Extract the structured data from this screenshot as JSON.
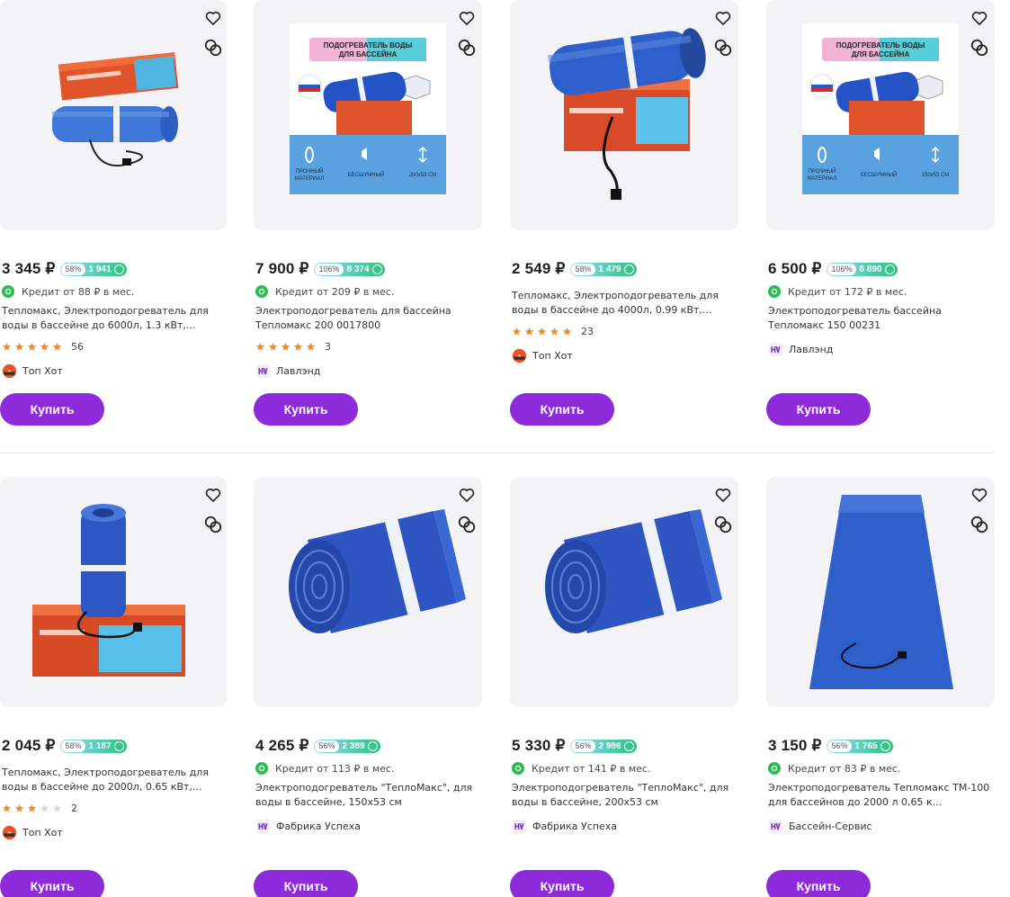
{
  "currency": "₽",
  "buy_label": "Купить",
  "colors": {
    "accent": "#8d2bdb",
    "credit": "#2bbd53",
    "star": "#f28a2a",
    "bonus_from": "#9ad8ff",
    "bonus_to": "#28c27b"
  },
  "products": [
    {
      "price": "3 345 ₽",
      "bonus_pct": "58%",
      "bonus_value": "1 941",
      "credit": "Кредит от 88 ₽ в мес.",
      "title": "Тепломакс, Электроподогреватель для воды в бассейне до 6000л, 1.3 кВт,...",
      "rating": 5,
      "reviews": "56",
      "seller": "Топ Хот",
      "seller_icon": "tophot-logo-icon",
      "image": "rolled-heater-with-box"
    },
    {
      "price": "7 900 ₽",
      "bonus_pct": "106%",
      "bonus_value": "8 374",
      "credit": "Кредит от 209 ₽ в мес.",
      "title": "Электроподогреватель для бассейна Тепломакс 200 0017800",
      "rating": 5,
      "reviews": "3",
      "seller": "Лавлэнд",
      "seller_icon": "lavland-logo-icon",
      "image": "promo-card",
      "promo": {
        "banner": "ПОДОГРЕВАТЕЛЬ ВОДЫ ДЛЯ БАССЕЙНА",
        "features": [
          "ПРОЧНЫЙ МАТЕРИАЛ",
          "БЕСШУМНЫЙ",
          "200х53 СМ"
        ]
      }
    },
    {
      "price": "2 549 ₽",
      "bonus_pct": "58%",
      "bonus_value": "1 479",
      "credit": "",
      "title": "Тепломакс, Электроподогреватель для воды в бассейне до 4000л, 0.99 кВт,...",
      "rating": 5,
      "reviews": "23",
      "seller": "Топ Хот",
      "seller_icon": "tophot-logo-icon",
      "image": "rolled-heater-on-box"
    },
    {
      "price": "6 500 ₽",
      "bonus_pct": "106%",
      "bonus_value": "6 890",
      "credit": "Кредит от 172 ₽ в мес.",
      "title": "Электроподогреватель бассейна Тепломакс 150 00231",
      "rating": 0,
      "reviews": "",
      "seller": "Лавлэнд",
      "seller_icon": "lavland-logo-icon",
      "image": "promo-card",
      "promo": {
        "banner": "ПОДОГРЕВАТЕЛЬ ВОДЫ ДЛЯ БАССЕЙНА",
        "features": [
          "ПРОЧНЫЙ МАТЕРИАЛ",
          "БЕСШУМНЫЙ",
          "150х53 СМ"
        ]
      }
    },
    {
      "price": "2 045 ₽",
      "bonus_pct": "58%",
      "bonus_value": "1 187",
      "credit": "",
      "title": "Тепломакс, Электроподогреватель для воды в бассейне до 2000л, 0.65 кВт,...",
      "rating": 3,
      "reviews": "2",
      "seller": "Топ Хот",
      "seller_icon": "tophot-logo-icon",
      "image": "standing-roll-with-box"
    },
    {
      "price": "4 265 ₽",
      "bonus_pct": "56%",
      "bonus_value": "2 389",
      "credit": "Кредит от 113 ₽ в мес.",
      "title": "Электроподогреватель \"ТеплоМакс\", для воды в бассейне, 150х53 см",
      "rating": 0,
      "reviews": "",
      "seller": "Фабрика Успеха",
      "seller_icon": "fabrika-logo-icon",
      "image": "rolled-mat"
    },
    {
      "price": "5 330 ₽",
      "bonus_pct": "56%",
      "bonus_value": "2 986",
      "credit": "Кредит от 141 ₽ в мес.",
      "title": "Электроподогреватель \"ТеплоМакс\", для воды в бассейне, 200х53 см",
      "rating": 0,
      "reviews": "",
      "seller": "Фабрика Успеха",
      "seller_icon": "fabrika-logo-icon",
      "image": "rolled-mat"
    },
    {
      "price": "3 150 ₽",
      "bonus_pct": "56%",
      "bonus_value": "1 765",
      "credit": "Кредит от 83 ₽ в мес.",
      "title": "Электроподогреватель Тепломакс ТМ-100 для бассейнов до 2000 л 0,65 к...",
      "rating": 0,
      "reviews": "",
      "seller": "Бассейн-Сервис",
      "seller_icon": "basseyn-logo-icon",
      "image": "flat-mat"
    }
  ]
}
